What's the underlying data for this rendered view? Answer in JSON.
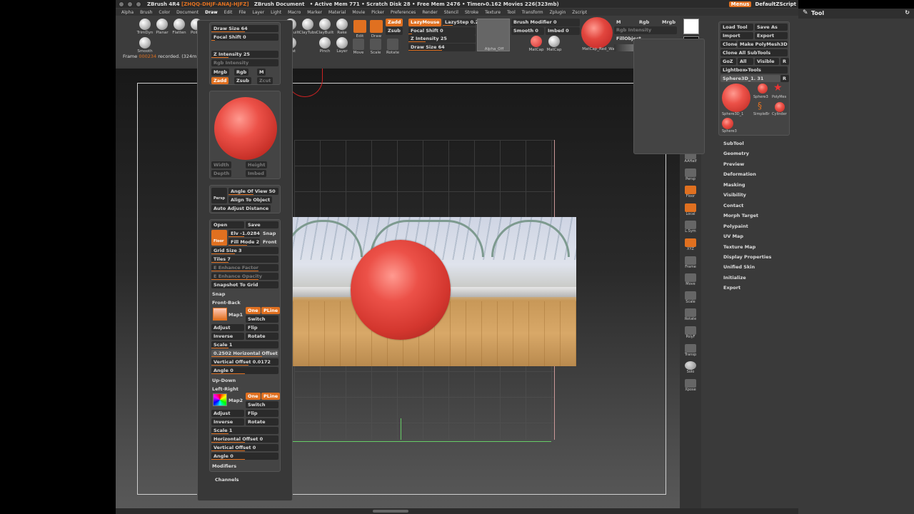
{
  "titlebar": {
    "app": "ZBrush 4R4",
    "code": "[ZHQQ-DHJF-ANAJ-HJFZ]",
    "document": "ZBrush Document",
    "stats": "• Active Mem 771 • Scratch Disk 28 • Free Mem 2476 • Timer▸0.162",
    "movies": "Movies 226(323mb)",
    "menus_label": "Menus",
    "script_label": "DefaultZScript"
  },
  "menubar": [
    "Alpha",
    "Brush",
    "Color",
    "Document",
    "Draw",
    "Edit",
    "File",
    "Layer",
    "Light",
    "Macro",
    "Marker",
    "Material",
    "Movie",
    "Picker",
    "Preferences",
    "Render",
    "Stencil",
    "Stroke",
    "Texture",
    "Tool",
    "Transform",
    "Zplugin",
    "Zscript"
  ],
  "menubar_active": "Draw",
  "top_shelf": {
    "brushes": [
      "TrimDyn",
      "Planar",
      "Flatten",
      "Polish",
      "ClayBuilt",
      "ClayTubs",
      "ClayBuilt",
      "Rake",
      "Inflat",
      "Pinch",
      "Layer",
      "Smooth"
    ],
    "move_label": "Move",
    "scale_label": "Scale",
    "rotate_label": "Rotate",
    "edit_label": "Edit",
    "draw_label": "Draw",
    "zadd": "Zadd",
    "zsub": "Zsub",
    "lazymouse": "LazyMouse",
    "lazystep": "LazyStep 0.25",
    "focal_shift": "Focal Shift 0",
    "z_intensity": "Z Intensity 25",
    "draw_size": "Draw Size 64",
    "alpha_off": "Alpha_Off",
    "brush_modifier": "Brush Modifier 0",
    "smooth": "Smooth 0",
    "imbed": "Imbed 0",
    "matcap": "MatCap",
    "matcap_red": "MatCap_Red_Wa",
    "m": "M",
    "rgb": "Rgb",
    "mrgb": "Mrgb",
    "rgb_intensity": "Rgb Intensity",
    "fillobject": "FillObject",
    "frame_text_1": "Frame ",
    "frame_num": "000234",
    "frame_text_2": " recorded. (324mb"
  },
  "draw_popup": {
    "draw_size": "Draw Size 64",
    "focal_shift": "Focal Shift 0",
    "z_intensity": "Z Intensity 25",
    "rgb_intensity": "Rgb Intensity",
    "mrgb": "Mrgb",
    "rgb": "Rgb",
    "m": "M",
    "zadd": "Zadd",
    "zsub": "Zsub",
    "zcut": "Zcut",
    "width": "Width",
    "height": "Height",
    "depth": "Depth",
    "imbed": "Imbed",
    "persp": "Persp",
    "angle_of_view": "Angle Of View 50",
    "align_to_object": "Align To Object",
    "auto_adjust_distance": "Auto Adjust Distance",
    "open": "Open",
    "save": "Save",
    "floor": "Floor",
    "elv": "Elv -1.0284",
    "snap_short": "Snap",
    "fill_mode": "Fill Mode 2",
    "front": "Front",
    "grid_size": "Grid Size 3",
    "tiles": "Tiles 7",
    "e_enhance_factor": "E Enhance Factor",
    "e_enhance_opacity": "E Enhance Opacity",
    "snapshot_to_grid": "Snapshot To Grid",
    "snap": "Snap",
    "front_back": "Front-Back",
    "map1": "Map1",
    "map2": "Map2",
    "one": "One",
    "pline": "PLine",
    "switch": "Switch",
    "adjust": "Adjust",
    "flip": "Flip",
    "inverse": "Inverse",
    "rotate": "Rotate",
    "scale": "Scale 1",
    "horizontal_offset_fb": "0.2502 Horizontal Offset",
    "vertical_offset_fb": "Vertical Offset 0.0172",
    "angle": "Angle 0",
    "up_down": "Up-Down",
    "left_right": "Left-Right",
    "horizontal_offset_lr": "Horizontal Offset 0",
    "vertical_offset_lr": "Vertical Offset 0",
    "modifiers": "Modifiers",
    "channels": "Channels"
  },
  "right_shelf": [
    "BPR",
    "SPix",
    "Scroll",
    "Zoom",
    "Actual",
    "AAHalf",
    "Persp",
    "Floor",
    "Local",
    "L.Sym",
    "XYZ",
    "Frame",
    "Move",
    "Scale",
    "Rotate",
    "PolyF",
    "Transp",
    "Solo",
    "Xpose"
  ],
  "tool_panel": {
    "title": "Tool",
    "load_tool": "Load Tool",
    "save_as": "Save As",
    "import": "Import",
    "export": "Export",
    "clone": "Clone",
    "make_polymesh": "Make PolyMesh3D",
    "clone_all_subtools": "Clone All SubTools",
    "goz": "GoZ",
    "all": "All",
    "visible": "Visible",
    "r": "R",
    "lightbox_tools": "Lightbox▸Tools",
    "current_tool": "Sphere3D_1. 31",
    "thumbs": [
      "Sphere3D_1",
      "Sphere3",
      "PolyMes",
      "SimpleBr",
      "Cylinder",
      "Sphere3"
    ],
    "sections": [
      "SubTool",
      "Geometry",
      "Preview",
      "Deformation",
      "Masking",
      "Visibility",
      "Contact",
      "Morph Target",
      "Polypaint",
      "UV Map",
      "Texture Map",
      "Display Properties",
      "Unified Skin",
      "Initialize",
      "Export"
    ]
  },
  "colors": {
    "accent": "#e07020",
    "sphere": "#e2463e",
    "panel": "#3a3a3a"
  }
}
